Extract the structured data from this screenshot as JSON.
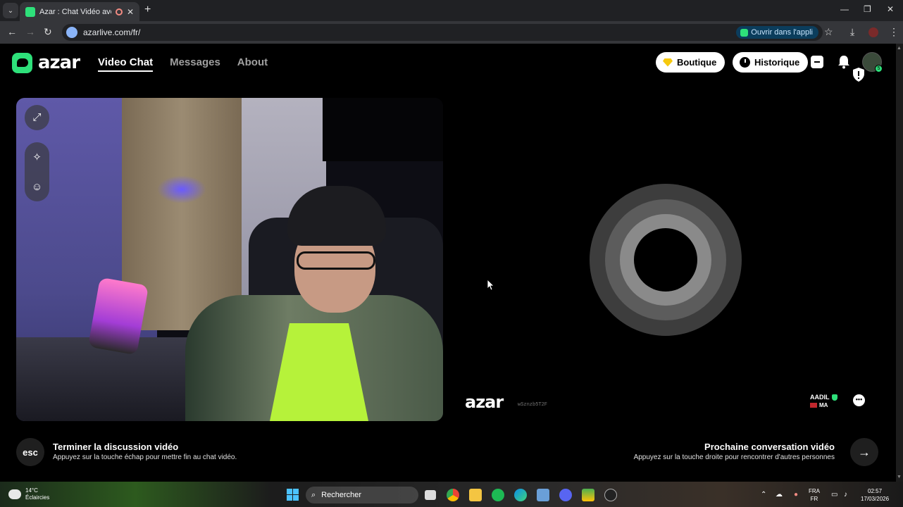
{
  "browser": {
    "tab_title": "Azar : Chat Vidéo avec de n",
    "url": "azarlive.com/fr/",
    "open_app_label": "Ouvrir dans l'appli"
  },
  "header": {
    "logo_text": "azar",
    "nav": [
      {
        "label": "Video Chat",
        "active": true
      },
      {
        "label": "Messages",
        "active": false
      },
      {
        "label": "About",
        "active": false
      }
    ],
    "boutique_label": "Boutique",
    "historique_label": "Historique",
    "avatar_badge": "5"
  },
  "remote": {
    "watermark_logo": "azar",
    "watermark_id": "wSznzb5T2F",
    "peer_name": "AADIL",
    "peer_country": "MA"
  },
  "controls": {
    "esc_label": "esc",
    "end_title": "Terminer la discussion vidéo",
    "end_sub": "Appuyez sur la touche échap pour mettre fin au chat vidéo.",
    "next_title": "Prochaine conversation vidéo",
    "next_sub": "Appuyez sur la touche droite pour rencontrer d'autres personnes"
  },
  "taskbar": {
    "temperature": "14°C",
    "weather": "Éclaircies",
    "search_placeholder": "Rechercher",
    "lang_top": "FRA",
    "lang_bottom": "FR",
    "time": "02:57",
    "date": "17/03/2026"
  },
  "colors": {
    "brand_green": "#2ee07a",
    "ring_outer": "#3d3d3d",
    "ring_mid": "#5c5c5c",
    "ring_inner": "#8a8a8a"
  }
}
